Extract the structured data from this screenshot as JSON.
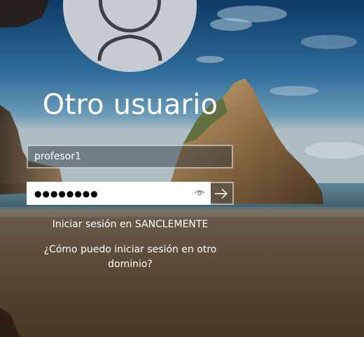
{
  "login": {
    "display_name": "Otro usuario",
    "username_value": "profesor1",
    "password_masked": "●●●●●●●●",
    "sign_in_to": "Iniciar sesión en SANCLEMENTE",
    "other_domain_link": "¿Cómo puedo iniciar sesión en otro dominio?"
  },
  "icons": {
    "avatar": "user-silhouette-icon",
    "reveal": "eye-icon",
    "submit": "arrow-right-icon"
  },
  "colors": {
    "avatar_bg": "#c5cbd1",
    "avatar_fg": "#3a4046",
    "text": "#ffffff",
    "password_bg": "#ffffff"
  }
}
